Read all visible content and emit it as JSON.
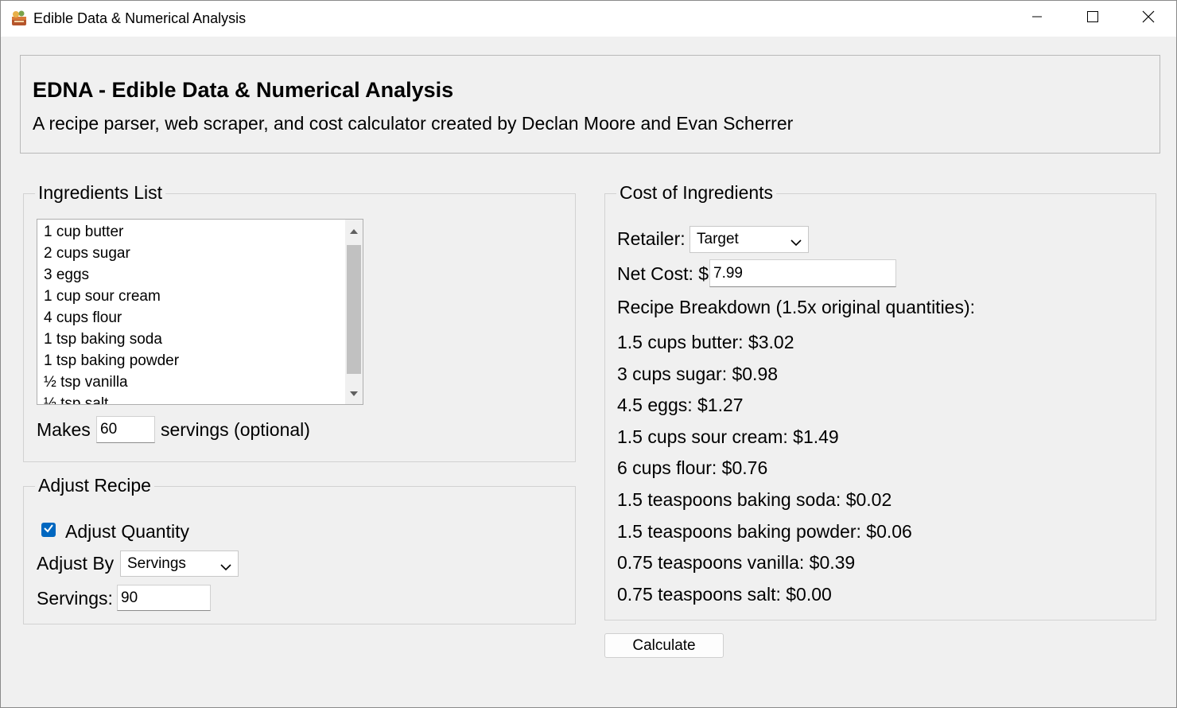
{
  "window": {
    "title": "Edible Data & Numerical Analysis",
    "icon": "recipe-app-icon",
    "controls": [
      "minimize-icon",
      "maximize-icon",
      "close-icon"
    ]
  },
  "header": {
    "title": "EDNA - Edible Data & Numerical Analysis",
    "subtitle": "A recipe parser, web scraper, and cost calculator created by Declan Moore and Evan Scherrer"
  },
  "ingredients": {
    "legend": "Ingredients List",
    "items": [
      "1 cup butter",
      "2 cups sugar",
      "3 eggs",
      "1 cup sour cream",
      "4 cups flour",
      "1 tsp baking soda",
      "1 tsp baking powder",
      "½ tsp vanilla",
      "½ tsp salt"
    ],
    "makes_label": "Makes",
    "servings_value": "60",
    "servings_suffix": "servings (optional)"
  },
  "adjust": {
    "legend": "Adjust Recipe",
    "checkbox_label": "Adjust Quantity",
    "checked": true,
    "adjust_by_label": "Adjust By",
    "adjust_by_value": "Servings",
    "servings_label": "Servings:",
    "servings_value": "90"
  },
  "cost": {
    "legend": "Cost of Ingredients",
    "retailer_label": "Retailer:",
    "retailer_value": "Target",
    "net_cost_label": "Net Cost: $",
    "net_cost_value": "7.99",
    "breakdown_title": "Recipe Breakdown (1.5x original quantities):",
    "breakdown": [
      "1.5 cups butter: $3.02",
      "3 cups sugar: $0.98",
      "4.5 eggs: $1.27",
      "1.5 cups sour cream: $1.49",
      "6 cups flour: $0.76",
      "1.5 teaspoons baking soda: $0.02",
      "1.5 teaspoons baking powder: $0.06",
      "0.75 teaspoons vanilla: $0.39",
      "0.75 teaspoons salt: $0.00"
    ]
  },
  "actions": {
    "calculate_label": "Calculate"
  },
  "colors": {
    "window_bg": "#f0f0f0",
    "accent": "#0067c0"
  }
}
